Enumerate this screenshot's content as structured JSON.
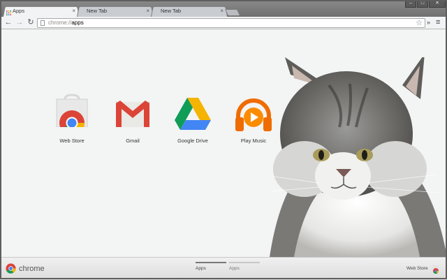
{
  "tabs": [
    {
      "label": "Apps",
      "active": true,
      "close": "×"
    },
    {
      "label": "New Tab",
      "active": false,
      "close": "×"
    },
    {
      "label": "New Tab",
      "active": false,
      "close": "×"
    }
  ],
  "window_controls": {
    "minimize": "–",
    "maximize": "□",
    "close": "✕"
  },
  "toolbar": {
    "back_glyph": "←",
    "forward_glyph": "→",
    "reload_glyph": "↻",
    "url_scheme": "chrome://",
    "url_path": "apps",
    "star_glyph": "☆",
    "extensions_glyph": "»",
    "menu_glyph": "≡"
  },
  "apps": [
    {
      "name": "Web Store",
      "icon": "web-store-icon"
    },
    {
      "name": "Gmail",
      "icon": "gmail-icon"
    },
    {
      "name": "Google Drive",
      "icon": "google-drive-icon"
    },
    {
      "name": "Play Music",
      "icon": "play-music-icon"
    }
  ],
  "footer": {
    "brand": "chrome",
    "pages": [
      {
        "label": "Apps",
        "active": true
      },
      {
        "label": "Apps",
        "active": false
      }
    ],
    "web_store_link": "Web Store"
  },
  "colors": {
    "chrome_red": "#db4437",
    "chrome_green": "#0f9d58",
    "chrome_yellow": "#f4b400",
    "chrome_blue": "#4285f4",
    "music_orange": "#ef6c00",
    "content_bg": "#f3f4f4"
  }
}
